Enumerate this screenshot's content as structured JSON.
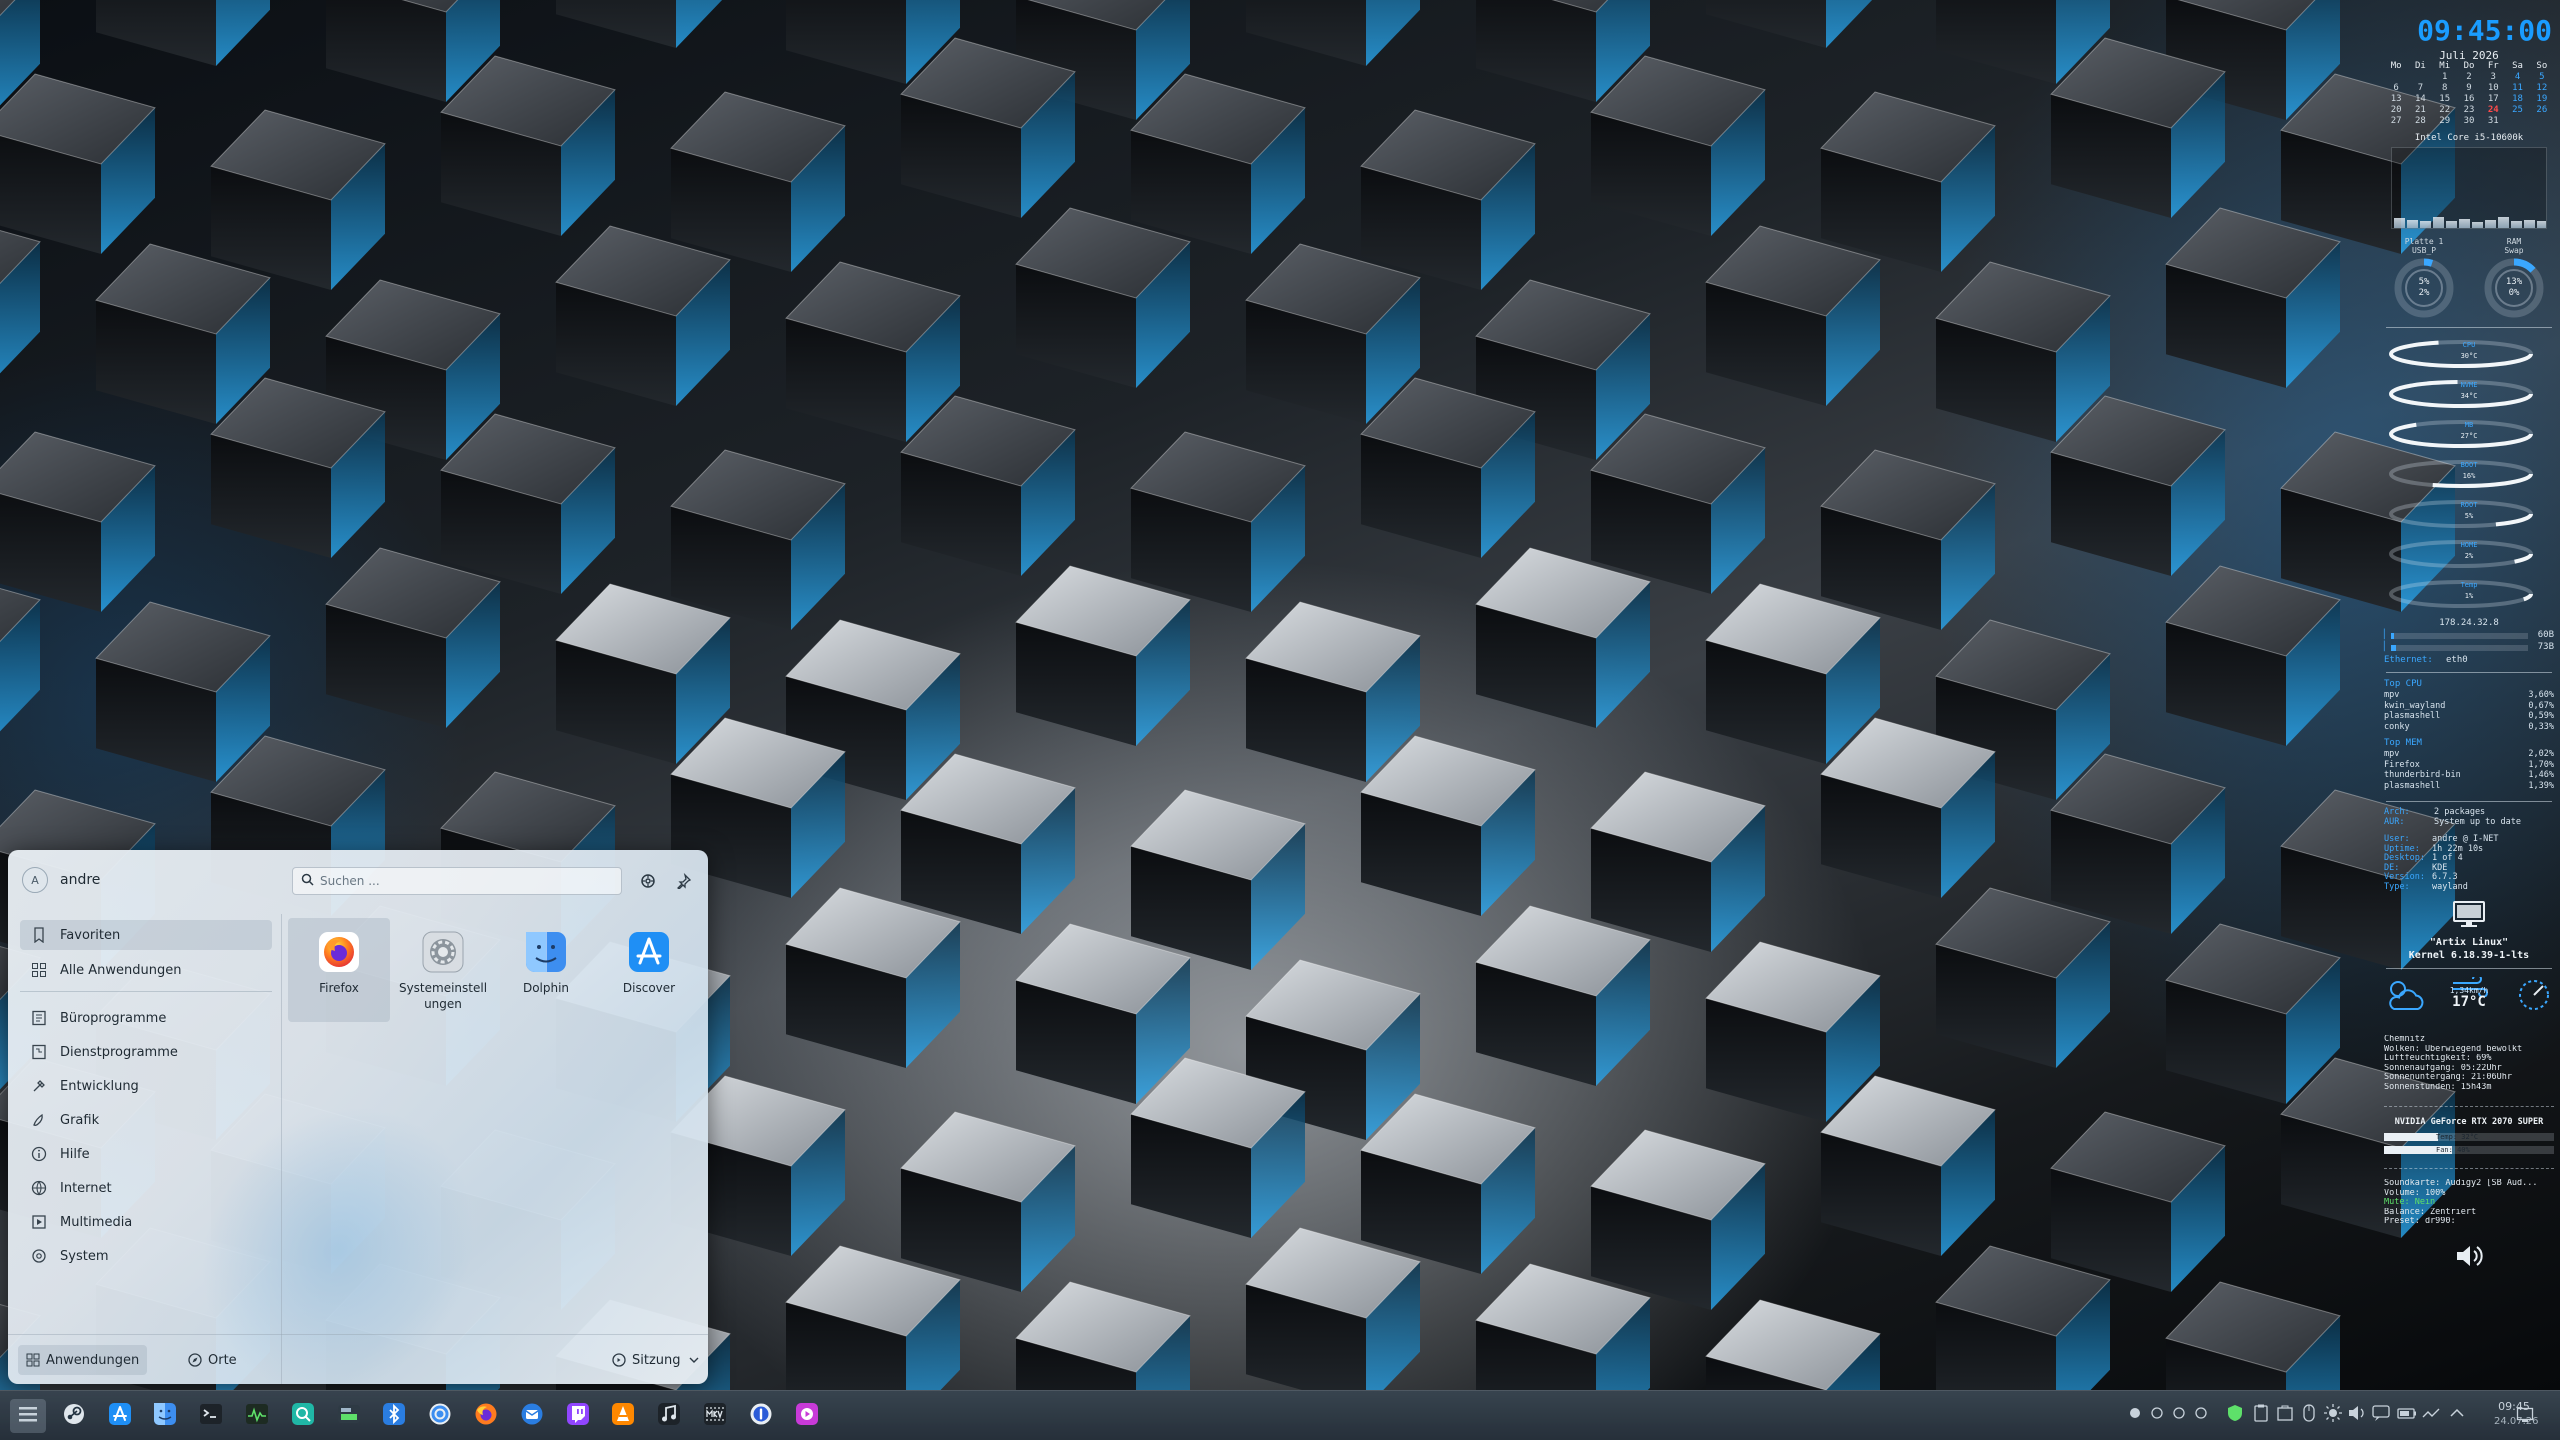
{
  "desktop": {
    "wallpaper": "blue-lit-metal-cubes"
  },
  "conky": {
    "time": "09:45:00",
    "calendar": {
      "month": "Juli 2026",
      "weekdays": [
        "Mo",
        "Di",
        "Mi",
        "Do",
        "Fr",
        "Sa",
        "So"
      ],
      "weeks": [
        [
          "",
          "",
          "1",
          "2",
          "3",
          "4",
          "5"
        ],
        [
          "6",
          "7",
          "8",
          "9",
          "10",
          "11",
          "12"
        ],
        [
          "13",
          "14",
          "15",
          "16",
          "17",
          "18",
          "19"
        ],
        [
          "20",
          "21",
          "22",
          "23",
          "24",
          "25",
          "26"
        ],
        [
          "27",
          "28",
          "29",
          "30",
          "31",
          "",
          ""
        ]
      ],
      "today": "24"
    },
    "cpu_name": "Intel Core i5-10600k",
    "cpu_bars": [
      0.12,
      0.1,
      0.08,
      0.14,
      0.09,
      0.11,
      0.07,
      0.1,
      0.13,
      0.08,
      0.1,
      0.09
    ],
    "disk": {
      "label1": "Platte 1",
      "label2": "USB_P",
      "value1": "5%",
      "value2": "2%",
      "fraction": 0.05
    },
    "ram": {
      "label1": "RAM",
      "label2": "Swap",
      "value1": "13%",
      "value2": "0%",
      "fraction": 0.13
    },
    "temps": [
      {
        "name": "CPU",
        "value": "30°C",
        "fraction": 0.62
      },
      {
        "name": "NVME",
        "value": "34°C",
        "fraction": 0.68
      },
      {
        "name": "MB",
        "value": "27°C",
        "fraction": 0.55
      },
      {
        "name": "BOOT",
        "value": "16%",
        "fraction": 0.32
      },
      {
        "name": "ROOT",
        "value": "5%",
        "fraction": 0.12
      },
      {
        "name": "HOME",
        "value": "2%",
        "fraction": 0.06
      },
      {
        "name": "Temp",
        "value": "1%",
        "fraction": 0.03
      }
    ],
    "ip": "178.24.32.8",
    "net_down": "60B",
    "net_up": "73B",
    "net_down_fraction": 0.02,
    "net_up_fraction": 0.03,
    "ethernet_label": "Ethernet:",
    "ethernet_value": "eth0",
    "top_cpu_title": "Top CPU",
    "top_cpu": [
      {
        "name": "mpv",
        "value": "3,60%"
      },
      {
        "name": "kwin_wayland",
        "value": "0,67%"
      },
      {
        "name": "plasmashell",
        "value": "0,59%"
      },
      {
        "name": "conky",
        "value": "0,33%"
      }
    ],
    "top_mem_title": "Top MEM",
    "top_mem": [
      {
        "name": "mpv",
        "value": "2,02%"
      },
      {
        "name": "Firefox",
        "value": "1,70%"
      },
      {
        "name": "thunderbird-bin",
        "value": "1,46%"
      },
      {
        "name": "plasmashell",
        "value": "1,39%"
      }
    ],
    "updates": [
      {
        "key": "Arch:",
        "value": "2 packages"
      },
      {
        "key": "AUR:",
        "value": "System up to date"
      }
    ],
    "sysinfo": [
      {
        "key": "User:",
        "value": "andre @ I-NET"
      },
      {
        "key": "Uptime:",
        "value": "1h 22m 10s"
      },
      {
        "key": "Desktop:",
        "value": "1 of 4"
      },
      {
        "key": "DE:",
        "value": "KDE"
      },
      {
        "key": "Version:",
        "value": "6.7.3"
      },
      {
        "key": "Type:",
        "value": "wayland"
      }
    ],
    "distro": "\"Artix Linux\"",
    "kernel": "Kernel 6.18.39-1-lts",
    "weather": {
      "wind": "1,34km/h",
      "temp": "17°C",
      "lines": [
        "Chemnitz",
        "Wolken: Überwiegend bewölkt",
        "Luftfeuchtigkeit: 69%",
        "Sonnenaufgang: 05:22Uhr",
        "Sonnenuntergang: 21:06Uhr",
        "Sonnenstunden: 15h43m"
      ]
    },
    "gpu_name": "NVIDIA GeForce RTX 2070 SUPER",
    "gpu_temp": "Temp: 32°C",
    "gpu_temp_fraction": 0.32,
    "gpu_fan": "Fan: 40%",
    "gpu_fan_fraction": 0.4,
    "sound": [
      {
        "key": "",
        "value": "Soundkarte: Audigy2 [SB Aud..."
      },
      {
        "key": "",
        "value": "Volume: 100%"
      },
      {
        "key": "",
        "value": "Mute: Nein"
      },
      {
        "key": "",
        "value": "Balance: Zentriert"
      },
      {
        "key": "",
        "value": "Preset: dr990:"
      }
    ]
  },
  "launcher": {
    "avatar_letter": "A",
    "username": "andre",
    "search_placeholder": "Suchen ...",
    "categories": [
      {
        "label": "Favoriten",
        "icon": "bookmark-icon"
      },
      {
        "label": "Alle Anwendungen",
        "icon": "grid-icon"
      },
      {
        "label": "Büroprogramme",
        "icon": "office-icon"
      },
      {
        "label": "Dienstprogramme",
        "icon": "utilities-icon"
      },
      {
        "label": "Entwicklung",
        "icon": "development-icon"
      },
      {
        "label": "Grafik",
        "icon": "graphics-icon"
      },
      {
        "label": "Hilfe",
        "icon": "help-icon"
      },
      {
        "label": "Internet",
        "icon": "globe-icon"
      },
      {
        "label": "Multimedia",
        "icon": "multimedia-icon"
      },
      {
        "label": "System",
        "icon": "system-icon"
      }
    ],
    "apps": [
      {
        "name": "Firefox",
        "icon": "firefox-icon"
      },
      {
        "name": "Systemeinstell ungen",
        "icon": "settings-icon"
      },
      {
        "name": "Dolphin",
        "icon": "dolphin-icon"
      },
      {
        "name": "Discover",
        "icon": "discover-icon"
      }
    ],
    "bottom": {
      "applications": "Anwendungen",
      "places": "Orte",
      "session": "Sitzung"
    }
  },
  "taskbar": {
    "apps": [
      "launcher-icon",
      "steam-icon",
      "app-store-icon",
      "finder-icon",
      "terminal-icon",
      "system-monitor-icon",
      "kde-connect-icon",
      "hardware-icon",
      "bluetooth-icon",
      "chrome-icon",
      "firefox-icon",
      "thunderbird-icon",
      "twitch-icon",
      "vlc-icon",
      "music-icon",
      "mkv-icon",
      "1password-icon",
      "media-player-icon"
    ],
    "clock_time": "09:45",
    "clock_date": "24.07.26"
  },
  "colors": {
    "accent": "#1a9cff",
    "today": "#ff4a4a",
    "conky_text": "#d8e4ee"
  }
}
